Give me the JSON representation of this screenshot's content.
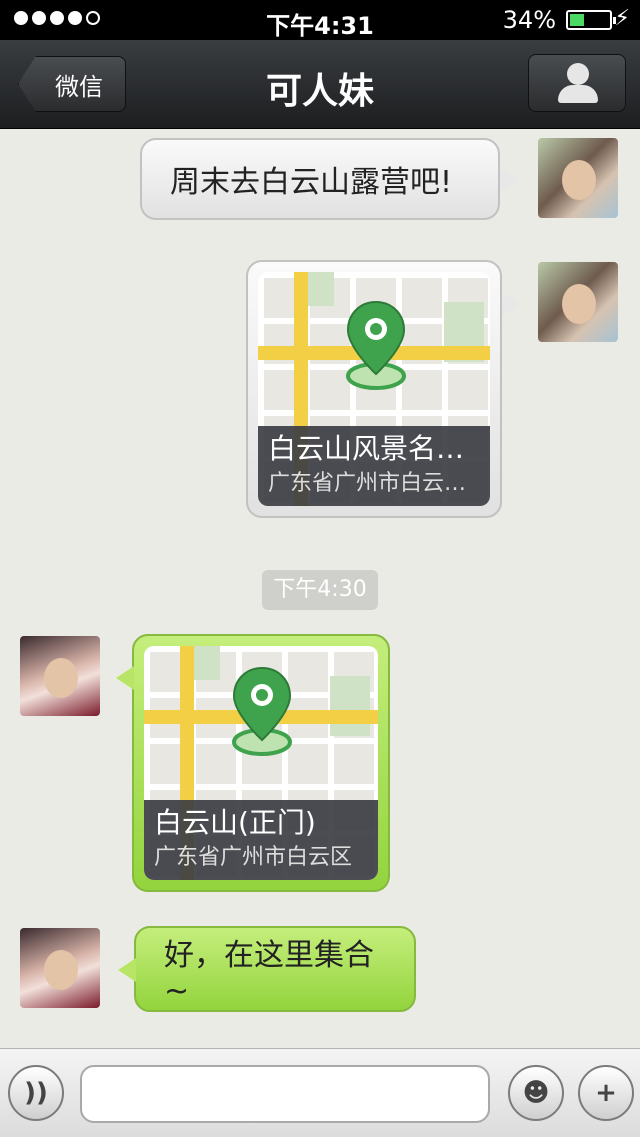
{
  "status_bar": {
    "time": "下午4:31",
    "battery_percent": "34%",
    "signal_bars": 4,
    "battery_level": 0.34
  },
  "nav": {
    "back_label": "微信",
    "title": "可人妹"
  },
  "messages": {
    "m1_text": "周末去白云山露营吧!",
    "m2_location": {
      "title": "白云山风景名…",
      "address": "广东省广州市白云…"
    },
    "timestamp": "下午4:30",
    "m3_location": {
      "title": "白云山(正门)",
      "address": "广东省广州市白云区"
    },
    "m4_text": "好，在这里集合~"
  },
  "input": {
    "value": "",
    "placeholder": ""
  },
  "colors": {
    "bubble_green": "#9bd843",
    "bubble_gray": "#ececec",
    "map_road": "#f2cf45",
    "pin_green": "#3fa34d"
  },
  "icons": [
    "voice-icon",
    "emoji-icon",
    "plus-icon",
    "person-icon",
    "location-pin-icon"
  ]
}
